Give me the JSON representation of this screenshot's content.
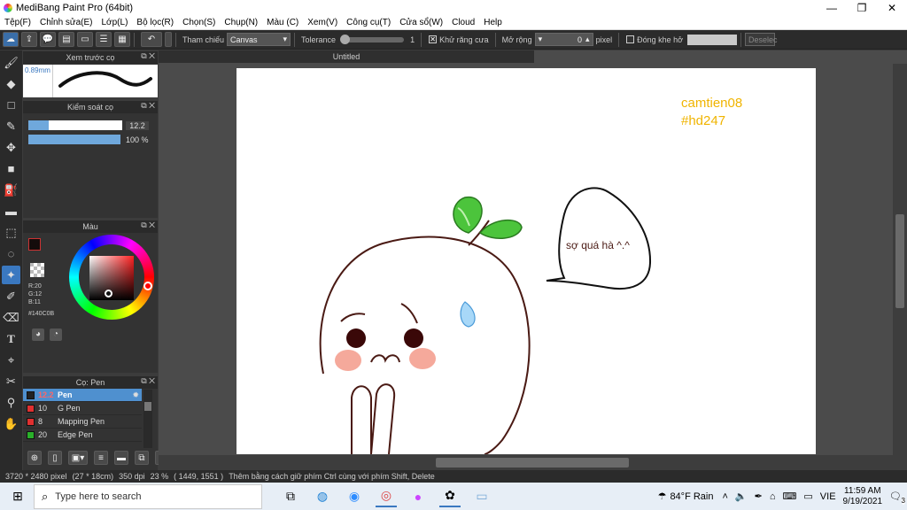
{
  "window": {
    "title": "MediBang Paint Pro (64bit)",
    "minimize": "—",
    "restore": "❐",
    "close": "✕"
  },
  "menu": [
    "Tệp(F)",
    "Chỉnh sửa(E)",
    "Lớp(L)",
    "Bộ lọc(R)",
    "Chọn(S)",
    "Chụp(N)",
    "Màu (C)",
    "Xem(V)",
    "Công cụ(T)",
    "Cửa sổ(W)",
    "Cloud",
    "Help"
  ],
  "toolbar": {
    "ref_label": "Tham chiếu",
    "ref_value": "Canvas",
    "tolerance_label": "Tolerance",
    "tolerance_value": "1",
    "antialias_label": "Khử răng cưa",
    "antialias_checked": "✕",
    "expand_label": "Mở rộng",
    "expand_value": "0",
    "expand_unit": "pixel",
    "close_gap_label": "Đóng khe hở",
    "deselect_label": "Deselec"
  },
  "panels": {
    "preview": {
      "title": "Xem trước cọ",
      "size": "0.89mm"
    },
    "brush_control": {
      "title": "Kiểm soát cọ",
      "size_value": "12.2",
      "opacity_value": "100 %",
      "size_fraction": 0.22,
      "opacity_fraction": 1.0
    },
    "color": {
      "title": "Màu",
      "r": "R:20",
      "g": "G:12",
      "b": "B:11",
      "hex": "#140C0B",
      "fg": "#140c0b"
    },
    "brushes": {
      "title": "Cọ: Pen",
      "items": [
        {
          "size": "12.2",
          "name": "Pen",
          "color": "#222222",
          "selected": true
        },
        {
          "size": "10",
          "name": "G Pen",
          "color": "#e03030",
          "selected": false
        },
        {
          "size": "8",
          "name": "Mapping Pen",
          "color": "#e03030",
          "selected": false
        },
        {
          "size": "20",
          "name": "Edge Pen",
          "color": "#2ab02a",
          "selected": false
        }
      ]
    }
  },
  "document": {
    "tab": "Untitled",
    "watermark_line1": "camtien08",
    "watermark_line2": "#hd247",
    "speech": "sợ quá hà ^.^"
  },
  "status": {
    "size": "3720 * 2480 pixel",
    "cm": "(27 * 18cm)",
    "dpi": "350 dpi",
    "zoom": "23 %",
    "coords": "( 1449, 1551 )",
    "hint": "Thêm bằng cách giữ phím Ctrl cùng với phím Shift, Delete"
  },
  "taskbar": {
    "search_placeholder": "Type here to search",
    "weather": "84°F Rain",
    "lang": "VIE",
    "time": "11:59 AM",
    "date": "9/19/2021",
    "notif": "3"
  },
  "colors": {
    "accent": "#3a78c0",
    "watermark": "#f0b400",
    "leaf": "#4cc43c"
  }
}
